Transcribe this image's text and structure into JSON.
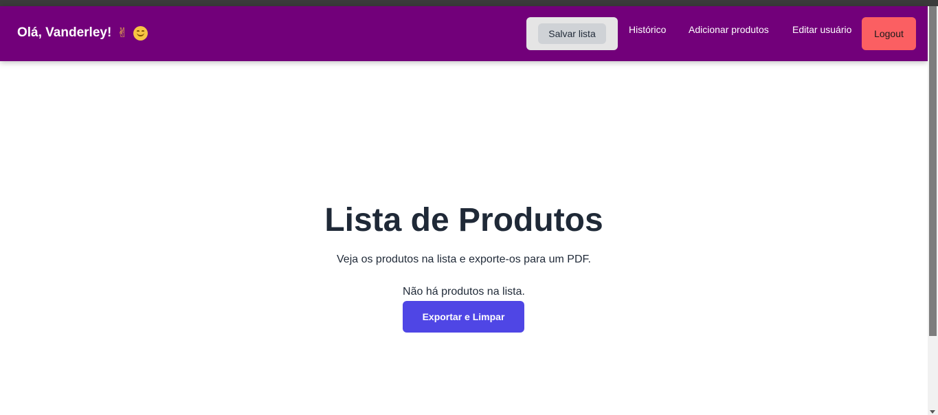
{
  "header": {
    "greeting": "Olá, Vanderley!",
    "emojis": [
      "✌",
      "😊"
    ],
    "save_list_label": "Salvar lista",
    "links": [
      "Histórico",
      "Adicionar produtos",
      "Editar usuário"
    ],
    "logout_label": "Logout",
    "colors": {
      "navbar": "#72007a",
      "logout": "#fb5f62"
    }
  },
  "main": {
    "title": "Lista de Produtos",
    "subtitle": "Veja os produtos na lista e exporte-os para um PDF.",
    "empty_message": "Não há produtos na lista.",
    "export_label": "Exportar e Limpar",
    "colors": {
      "export_button": "#4f46e5"
    }
  }
}
